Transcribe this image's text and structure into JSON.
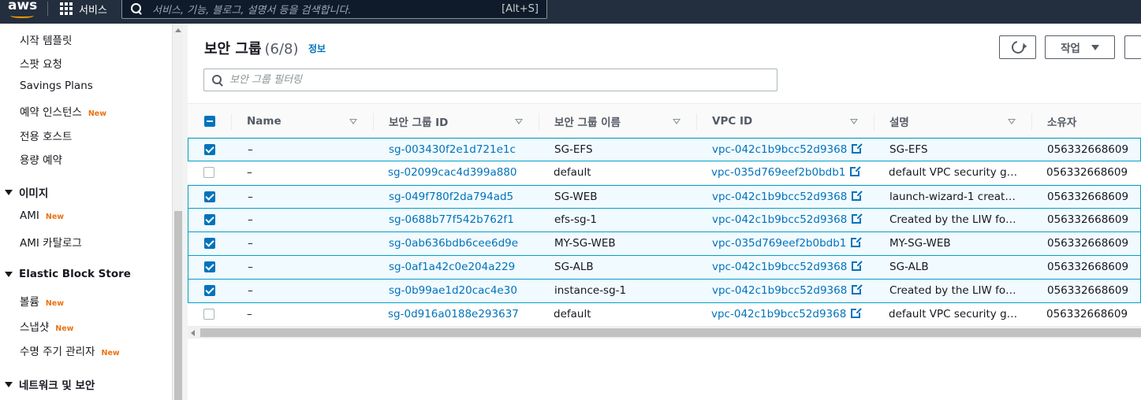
{
  "topnav": {
    "logo": "aws",
    "services_label": "서비스",
    "search_placeholder": "서비스, 기능, 블로그, 설명서 등을 검색합니다.",
    "search_shortcut": "[Alt+S]"
  },
  "sidebar": {
    "items": [
      {
        "label": "시작 템플릿",
        "new": ""
      },
      {
        "label": "스팟 요청",
        "new": ""
      },
      {
        "label": "Savings Plans",
        "new": ""
      },
      {
        "label": "예약 인스턴스",
        "new": "New"
      },
      {
        "label": "전용 호스트",
        "new": ""
      },
      {
        "label": "용량 예약",
        "new": ""
      }
    ],
    "section_images": "이미지",
    "image_items": [
      {
        "label": "AMI",
        "new": "New"
      },
      {
        "label": "AMI 카탈로그",
        "new": ""
      }
    ],
    "section_ebs": "Elastic Block Store",
    "ebs_items": [
      {
        "label": "볼륨",
        "new": "New"
      },
      {
        "label": "스냅샷",
        "new": "New"
      },
      {
        "label": "수명 주기 관리자",
        "new": "New"
      }
    ],
    "section_network": "네트워크 및 보안"
  },
  "panel": {
    "title": "보안 그룹",
    "count": "(6/8)",
    "info": "정보",
    "actions_label": "작업",
    "filter_placeholder": "보안 그룹 필터링"
  },
  "table": {
    "columns": [
      "Name",
      "보안 그룹 ID",
      "보안 그룹 이름",
      "VPC ID",
      "설명",
      "소유자"
    ],
    "rows": [
      {
        "selected": true,
        "name": "–",
        "sg_id": "sg-003430f2e1d721e1c",
        "sg_name": "SG-EFS",
        "vpc_id": "vpc-042c1b9bcc52d9368",
        "desc": "SG-EFS",
        "owner": "056332668609"
      },
      {
        "selected": false,
        "name": "–",
        "sg_id": "sg-02099cac4d399a880",
        "sg_name": "default",
        "vpc_id": "vpc-035d769eef2b0bdb1",
        "desc": "default VPC security gr…",
        "owner": "056332668609"
      },
      {
        "selected": true,
        "name": "–",
        "sg_id": "sg-049f780f2da794ad5",
        "sg_name": "SG-WEB",
        "vpc_id": "vpc-042c1b9bcc52d9368",
        "desc": "launch-wizard-1 create…",
        "owner": "056332668609"
      },
      {
        "selected": true,
        "name": "–",
        "sg_id": "sg-0688b77f542b762f1",
        "sg_name": "efs-sg-1",
        "vpc_id": "vpc-042c1b9bcc52d9368",
        "desc": "Created by the LIW for…",
        "owner": "056332668609"
      },
      {
        "selected": true,
        "name": "–",
        "sg_id": "sg-0ab636bdb6cee6d9e",
        "sg_name": "MY-SG-WEB",
        "vpc_id": "vpc-035d769eef2b0bdb1",
        "desc": "MY-SG-WEB",
        "owner": "056332668609"
      },
      {
        "selected": true,
        "name": "–",
        "sg_id": "sg-0af1a42c0e204a229",
        "sg_name": "SG-ALB",
        "vpc_id": "vpc-042c1b9bcc52d9368",
        "desc": "SG-ALB",
        "owner": "056332668609"
      },
      {
        "selected": true,
        "name": "–",
        "sg_id": "sg-0b99ae1d20cac4e30",
        "sg_name": "instance-sg-1",
        "vpc_id": "vpc-042c1b9bcc52d9368",
        "desc": "Created by the LIW for…",
        "owner": "056332668609"
      },
      {
        "selected": false,
        "name": "–",
        "sg_id": "sg-0d916a0188e293637",
        "sg_name": "default",
        "vpc_id": "vpc-042c1b9bcc52d9368",
        "desc": "default VPC security gr…",
        "owner": "056332668609"
      }
    ]
  },
  "icons": {
    "services": "grid-icon",
    "search": "search-icon",
    "refresh": "refresh-icon",
    "external_link": "external-link-icon",
    "sort": "sort-icon",
    "expand": "caret-down-icon"
  },
  "colors": {
    "nav_bg": "#232f3e",
    "accent": "#ff9900",
    "link": "#0073bb",
    "selected_bg": "#f1faff",
    "selected_border": "#00a1c9",
    "new_badge": "#ec7211"
  }
}
